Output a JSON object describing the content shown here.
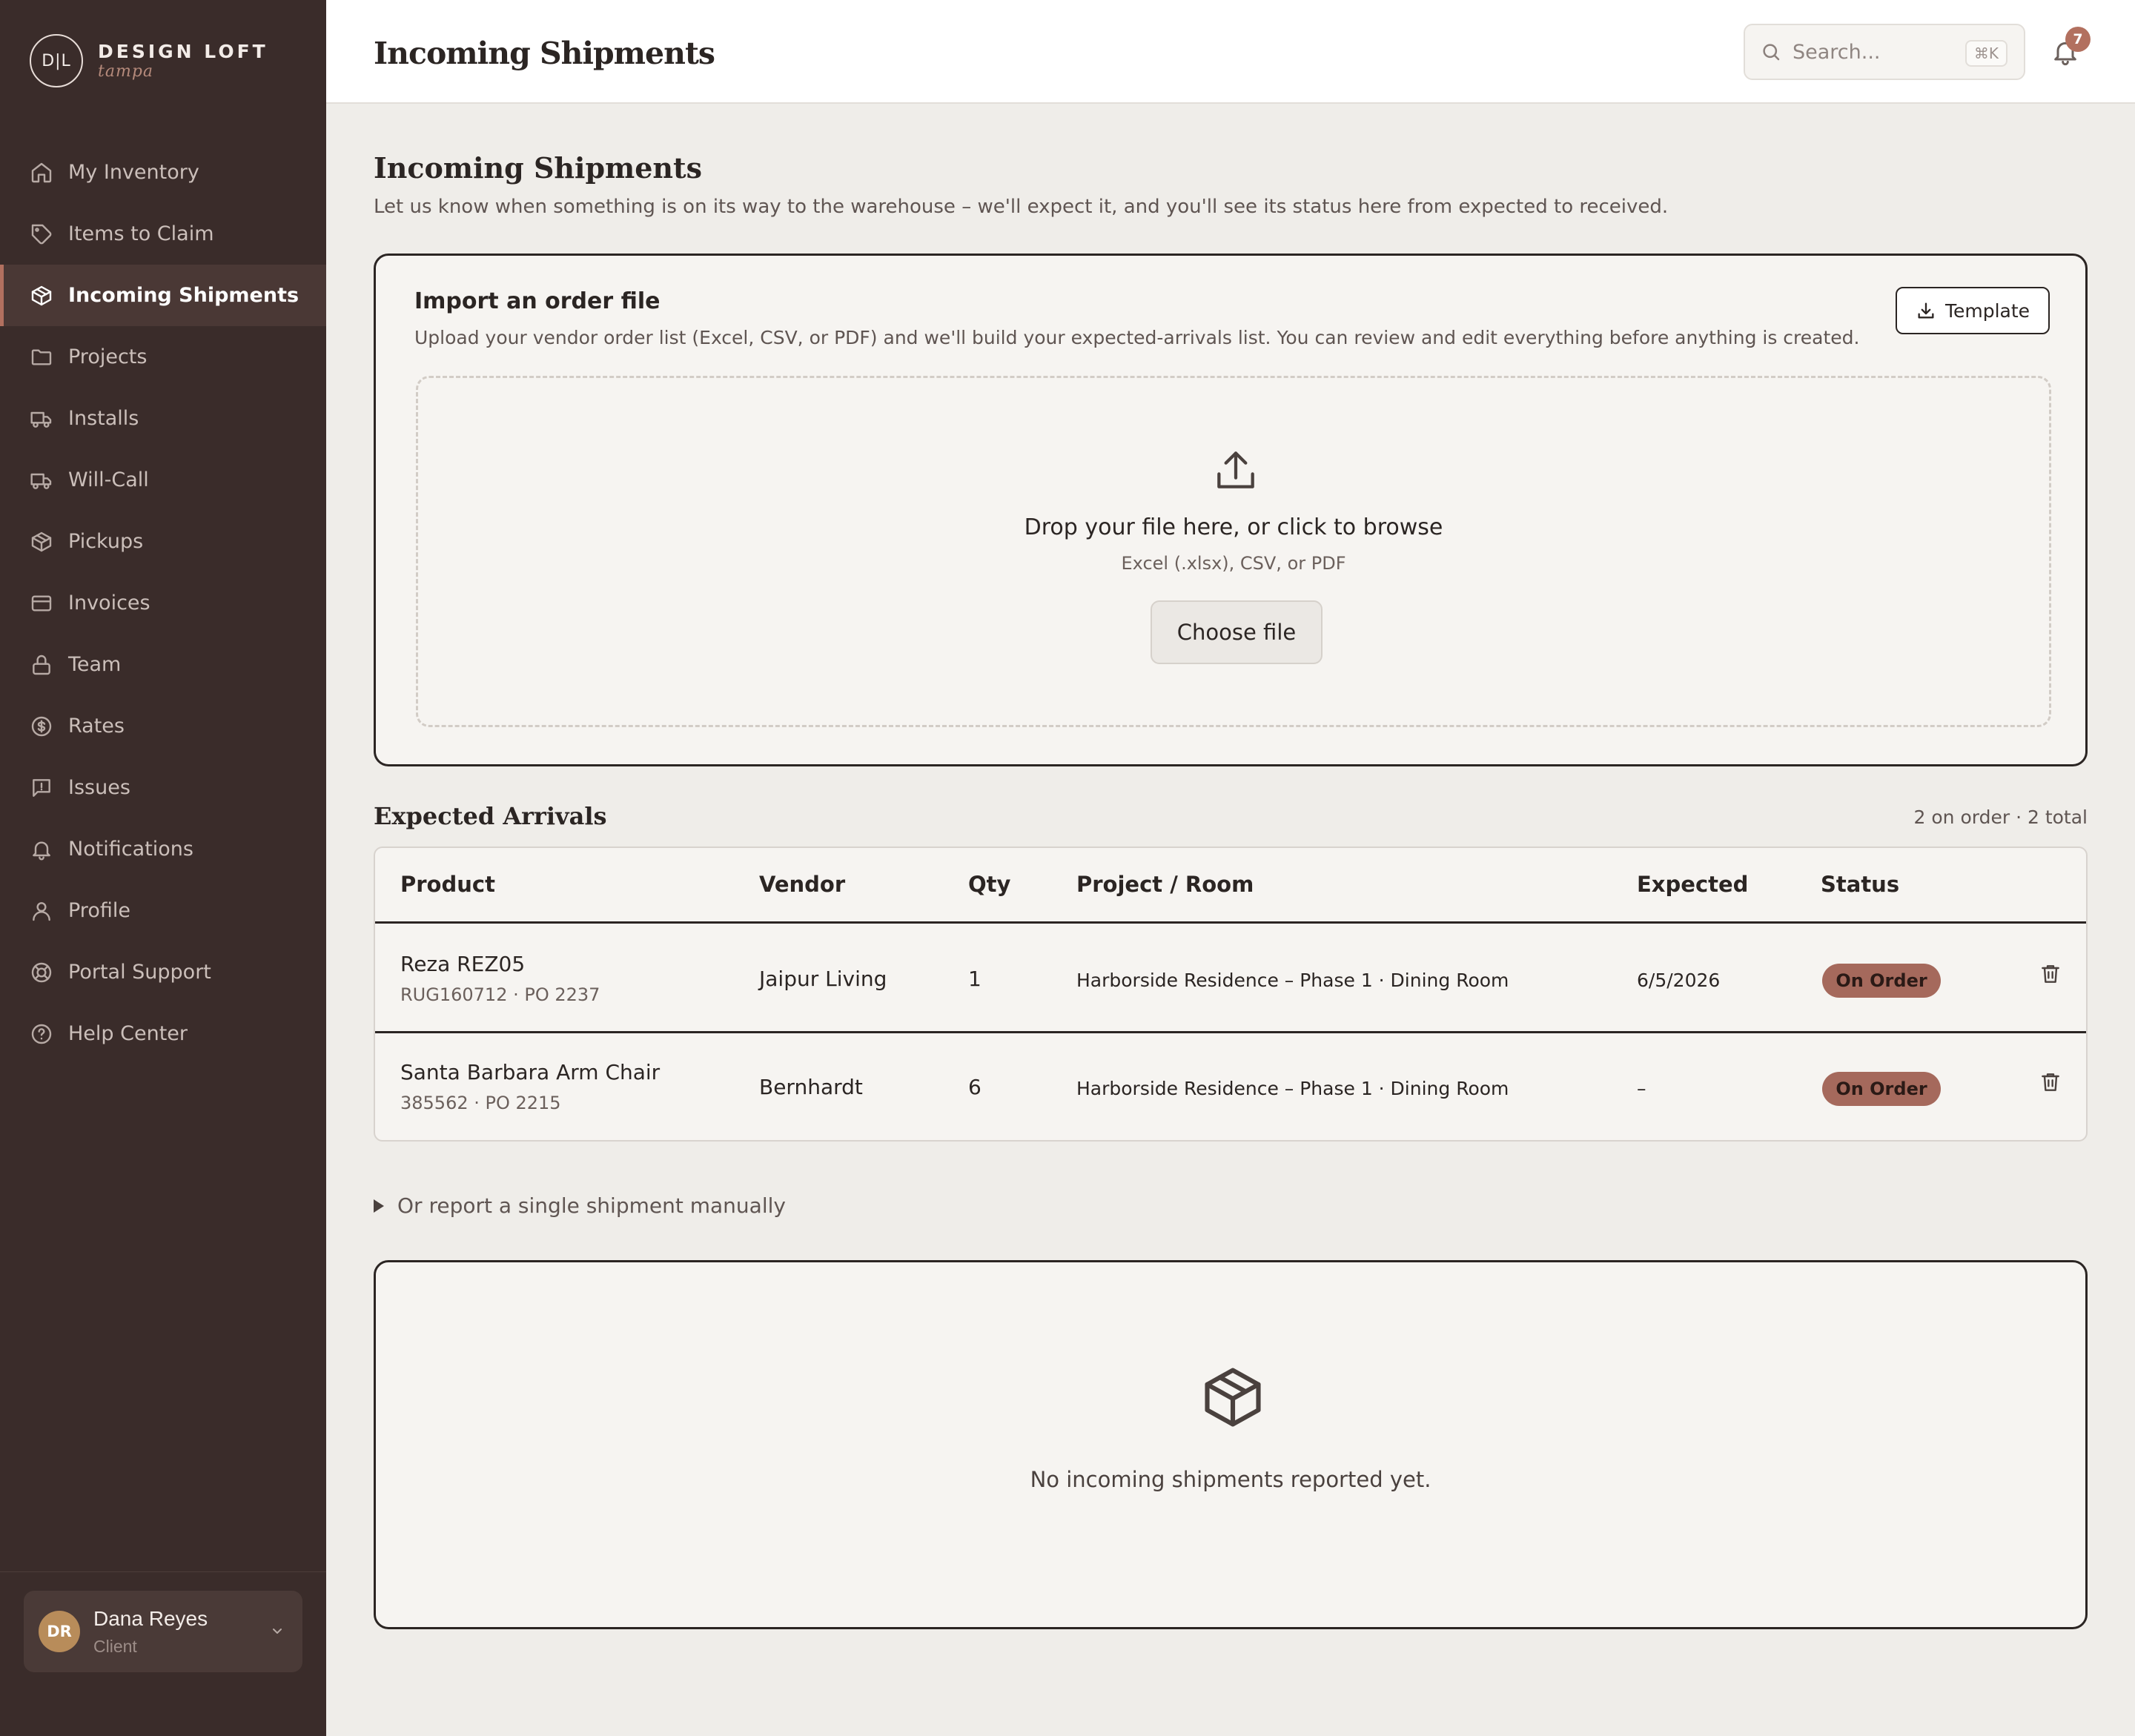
{
  "brand": {
    "monogram": "D|L",
    "name": "DESIGN LOFT",
    "script": "tampa"
  },
  "sidebar": {
    "items": [
      {
        "label": "My Inventory",
        "icon": "home-icon",
        "active": false
      },
      {
        "label": "Items to Claim",
        "icon": "tag-icon",
        "active": false
      },
      {
        "label": "Incoming Shipments",
        "icon": "box-icon",
        "active": true
      },
      {
        "label": "Projects",
        "icon": "folder-icon",
        "active": false
      },
      {
        "label": "Installs",
        "icon": "truck-icon",
        "active": false
      },
      {
        "label": "Will-Call",
        "icon": "truck-icon",
        "active": false
      },
      {
        "label": "Pickups",
        "icon": "box-icon",
        "active": false
      },
      {
        "label": "Invoices",
        "icon": "credit-card-icon",
        "active": false
      },
      {
        "label": "Team",
        "icon": "lock-icon",
        "active": false
      },
      {
        "label": "Rates",
        "icon": "dollar-icon",
        "active": false
      },
      {
        "label": "Issues",
        "icon": "message-alert-icon",
        "active": false
      },
      {
        "label": "Notifications",
        "icon": "bell-icon",
        "active": false
      },
      {
        "label": "Profile",
        "icon": "user-icon",
        "active": false
      },
      {
        "label": "Portal Support",
        "icon": "lifebuoy-icon",
        "active": false
      },
      {
        "label": "Help Center",
        "icon": "help-circle-icon",
        "active": false
      }
    ]
  },
  "user": {
    "initials": "DR",
    "name": "Dana Reyes",
    "role": "Client"
  },
  "header": {
    "title": "Incoming Shipments",
    "search_placeholder": "Search...",
    "search_shortcut": "⌘K",
    "notification_count": "7"
  },
  "main": {
    "title": "Incoming Shipments",
    "description": "Let us know when something is on its way to the warehouse – we'll expect it, and you'll see its status here from expected to received."
  },
  "import": {
    "title": "Import an order file",
    "description": "Upload your vendor order list (Excel, CSV, or PDF) and we'll build your expected-arrivals list. You can review and edit everything before anything is created.",
    "template_label": "Template",
    "drop_title": "Drop your file here, or click to browse",
    "drop_sub": "Excel (.xlsx), CSV, or PDF",
    "choose_label": "Choose file"
  },
  "arrivals": {
    "title": "Expected Arrivals",
    "count": "2 on order · 2 total",
    "columns": [
      "Product",
      "Vendor",
      "Qty",
      "Project / Room",
      "Expected",
      "Status"
    ],
    "rows": [
      {
        "product": "Reza REZ05",
        "sub": "RUG160712 · PO 2237",
        "vendor": "Jaipur Living",
        "qty": "1",
        "project": "Harborside Residence – Phase 1 · Dining Room",
        "expected": "6/5/2026",
        "status": "On Order"
      },
      {
        "product": "Santa Barbara Arm Chair",
        "sub": "385562 · PO 2215",
        "vendor": "Bernhardt",
        "qty": "6",
        "project": "Harborside Residence – Phase 1 · Dining Room",
        "expected": "–",
        "status": "On Order"
      }
    ]
  },
  "manual": {
    "toggle_label": "Or report a single shipment manually"
  },
  "empty": {
    "text": "No incoming shipments reported yet."
  },
  "colors": {
    "sidebar": "#3a2c2a",
    "accent": "#b2705f",
    "status_badge": "#a5695c",
    "background": "#efede9"
  }
}
